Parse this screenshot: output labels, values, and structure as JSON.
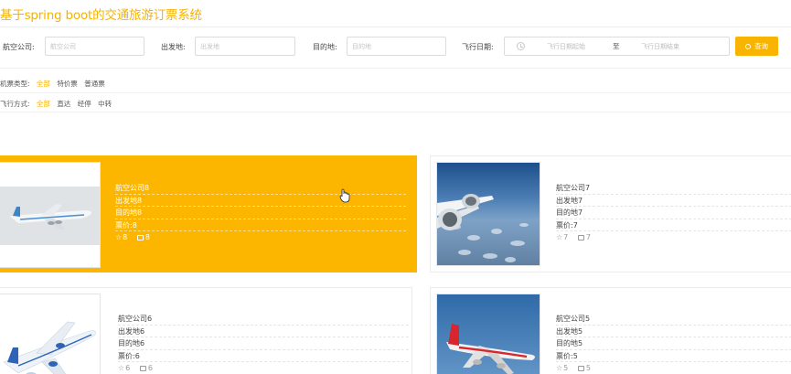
{
  "app": {
    "title": "基于spring boot的交通旅游订票系统"
  },
  "search": {
    "airline_label": "航空公司:",
    "airline_placeholder": "航空公司",
    "origin_label": "出发地:",
    "origin_placeholder": "出发地",
    "destination_label": "目的地:",
    "destination_placeholder": "目的地",
    "date_label": "飞行日期:",
    "date_start_placeholder": "飞行日期起始",
    "date_separator": "至",
    "date_end_placeholder": "飞行日期结束",
    "search_button": "查询"
  },
  "filters": {
    "ticket_type": {
      "label": "机票类型:",
      "options": [
        "全部",
        "特价票",
        "普通票"
      ],
      "selected": "全部"
    },
    "flight_mode": {
      "label": "飞行方式:",
      "options": [
        "全部",
        "直达",
        "经停",
        "中转"
      ],
      "selected": "全部"
    }
  },
  "accent_color": "#f8b400",
  "flights": [
    {
      "airline": "航空公司8",
      "origin": "出发地8",
      "destination": "目的地8",
      "price": "票价:8",
      "favorites": "8",
      "comments": "8",
      "highlighted": true
    },
    {
      "airline": "航空公司7",
      "origin": "出发地7",
      "destination": "目的地7",
      "price": "票价:7",
      "favorites": "7",
      "comments": "7",
      "highlighted": false
    },
    {
      "airline": "航空公司6",
      "origin": "出发地6",
      "destination": "目的地6",
      "price": "票价:6",
      "favorites": "6",
      "comments": "6",
      "highlighted": false
    },
    {
      "airline": "航空公司5",
      "origin": "出发地5",
      "destination": "目的地5",
      "price": "票价:5",
      "favorites": "5",
      "comments": "5",
      "highlighted": false
    }
  ]
}
